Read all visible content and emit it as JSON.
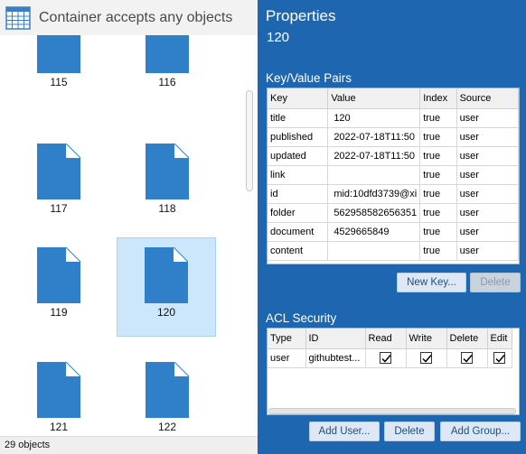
{
  "left_pane": {
    "title": "Container accepts any objects",
    "items": [
      {
        "label": "115",
        "selected": false
      },
      {
        "label": "116",
        "selected": false
      },
      {
        "label": "117",
        "selected": false
      },
      {
        "label": "118",
        "selected": false
      },
      {
        "label": "119",
        "selected": false
      },
      {
        "label": "120",
        "selected": true
      },
      {
        "label": "121",
        "selected": false
      },
      {
        "label": "122",
        "selected": false
      }
    ],
    "status": "29 objects"
  },
  "properties": {
    "title": "Properties",
    "subtitle": "120",
    "kv_section": {
      "title": "Key/Value Pairs",
      "columns": [
        "Key",
        "Value",
        "Index",
        "Source"
      ],
      "rows": [
        [
          "title",
          "120",
          "true",
          "user"
        ],
        [
          "published",
          "2022-07-18T11:50",
          "true",
          "user"
        ],
        [
          "updated",
          "2022-07-18T11:50",
          "true",
          "user"
        ],
        [
          "link",
          "",
          "true",
          "user"
        ],
        [
          "id",
          "mid:10dfd3739@xi",
          "true",
          "user"
        ],
        [
          "folder",
          "562958582656351",
          "true",
          "user"
        ],
        [
          "document",
          "4529665849",
          "true",
          "user"
        ],
        [
          "content",
          "",
          "true",
          "user"
        ]
      ],
      "new_key_label": "New Key...",
      "delete_label": "Delete"
    },
    "acl_section": {
      "title": "ACL Security",
      "columns": [
        "Type",
        "ID",
        "Read",
        "Write",
        "Delete",
        "Edit"
      ],
      "rows": [
        {
          "type": "user",
          "id": "githubtest...",
          "read": true,
          "write": true,
          "delete": true,
          "edit": true
        }
      ],
      "add_user_label": "Add User...",
      "delete_label": "Delete",
      "add_group_label": "Add Group..."
    }
  },
  "colors": {
    "panel_blue": "#1e67b0",
    "doc_blue": "#2f80c9",
    "selection": "#cce6fb"
  }
}
